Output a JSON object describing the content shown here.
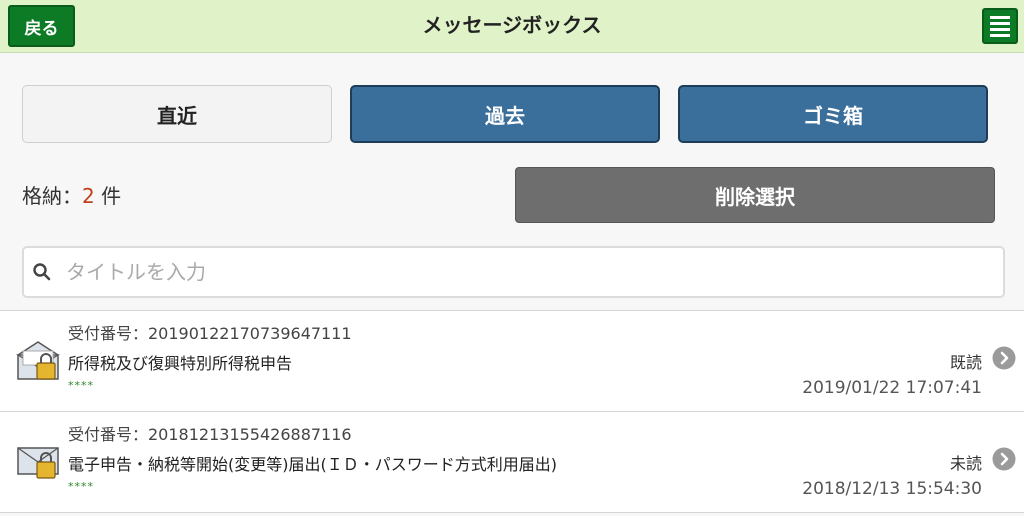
{
  "header": {
    "back_label": "戻る",
    "title": "メッセージボックス",
    "menu_icon": "hamburger-menu-icon"
  },
  "tabs": [
    {
      "label": "直近",
      "state": "active"
    },
    {
      "label": "過去",
      "state": "inactive"
    },
    {
      "label": "ゴミ箱",
      "state": "inactive"
    }
  ],
  "summary": {
    "count_prefix": "格納：",
    "count_value": "2",
    "count_suffix": "件"
  },
  "delete_label": "削除選択",
  "search": {
    "placeholder": "タイトルを入力",
    "value": ""
  },
  "messages": [
    {
      "receipt": "受付番号：20190122170739647111",
      "subject": "所得税及び復興特別所得税申告",
      "stars": "****",
      "status": "既読",
      "date": "2019/01/22 17:07:41",
      "icon": "opened-envelope-lock-icon"
    },
    {
      "receipt": "受付番号：20181213155426887116",
      "subject": "電子申告・納税等開始(変更等)届出(ＩＤ・パスワード方式利用届出)",
      "stars": "****",
      "status": "未読",
      "date": "2018/12/13 15:54:30",
      "icon": "closed-envelope-lock-icon"
    }
  ],
  "colors": {
    "header_bg": "#dff2c8",
    "green_button": "#0d7a25",
    "tab_blue": "#3a6e9b",
    "delete_gray": "#6e6e6e",
    "count_accent": "#c0401a"
  }
}
